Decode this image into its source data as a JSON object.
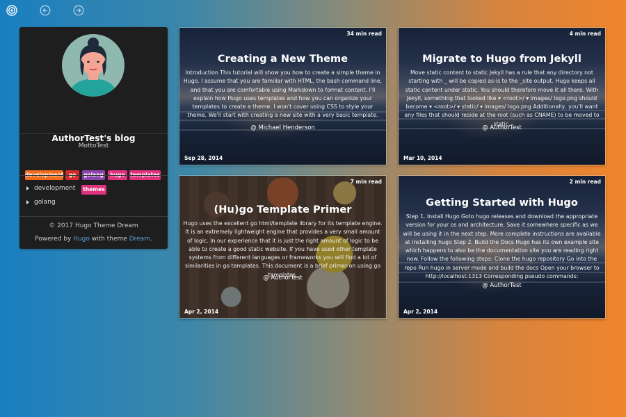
{
  "topnav": {
    "icons": [
      "target-icon",
      "arrow-left-icon",
      "arrow-right-icon"
    ]
  },
  "sidebar": {
    "blog_title": "AuthorTest's blog",
    "motto": "MottoTest",
    "tags": [
      {
        "label": "development",
        "color": "#f26b1d"
      },
      {
        "label": "go",
        "color": "#d02c2c"
      },
      {
        "label": "golang",
        "color": "#8e44ad"
      },
      {
        "label": "hugo",
        "color": "#e0317f"
      },
      {
        "label": "templates",
        "color": "#e0317f"
      },
      {
        "label": "themes",
        "color": "#e0317f"
      }
    ],
    "categories": [
      "development",
      "golang"
    ],
    "footer": {
      "copyright": "© 2017 Hugo Theme Dream",
      "powered_prefix": "Powered by",
      "powered_hugo": "Hugo",
      "powered_middle": "with theme",
      "powered_theme": "Dream",
      "powered_suffix": "."
    }
  },
  "posts": [
    {
      "title": "Creating a New Theme",
      "read_time": "34 min read",
      "date": "Sep 28, 2014",
      "summary": "Introduction This tutorial will show you how to create a simple theme in Hugo. I assume that you are familiar with HTML, the bash command line, and that you are comfortable using Markdown to format content. I'll explain how Hugo uses templates and how you can organize your templates to create a theme. I won't cover using CSS to style your theme. We'll start with creating a new site with a very basic template.",
      "author": "@ Michael Henderson"
    },
    {
      "title": "Migrate to Hugo from Jekyll",
      "read_time": "4 min read",
      "date": "Mar 10, 2014",
      "summary": "Move static content to static Jekyll has a rule that any directory not starting with _ will be copied as-is to the _site output. Hugo keeps all static content under static. You should therefore move it all there. With Jekyll, something that looked like ▾ <root>/ ▾ images/ logo.png should become ▾ <root>/ ▾ static/ ▾ images/ logo.png Additionally, you'll want any files that should reside at the root (such as CNAME) to be moved to static.",
      "author": "@ AuthorTest"
    },
    {
      "title": "(Hu)go Template Primer",
      "read_time": "7 min read",
      "date": "Apr 2, 2014",
      "summary": "Hugo uses the excellent go html/template library for its template engine. It is an extremely lightweight engine that provides a very small amount of logic. In our experience that it is just the right amount of logic to be able to create a good static website. If you have used other template systems from different languages or frameworks you will find a lot of similarities in go templates. This document is a brief primer on using go templates.",
      "author": "@ AuthorTest"
    },
    {
      "title": "Getting Started with Hugo",
      "read_time": "2 min read",
      "date": "Apr 2, 2014",
      "summary": "Step 1. Install Hugo Goto hugo releases and download the appropriate version for your os and architecture. Save it somewhere specific as we will be using it in the next step. More complete instructions are available at installing hugo Step 2. Build the Docs Hugo has its own example site which happens to also be the documentation site you are reading right now. Follow the following steps: Clone the hugo repository Go into the repo Run hugo in server mode and build the docs Open your browser to http://localhost:1313 Corresponding pseudo commands:",
      "author": "@ AuthorTest"
    }
  ]
}
